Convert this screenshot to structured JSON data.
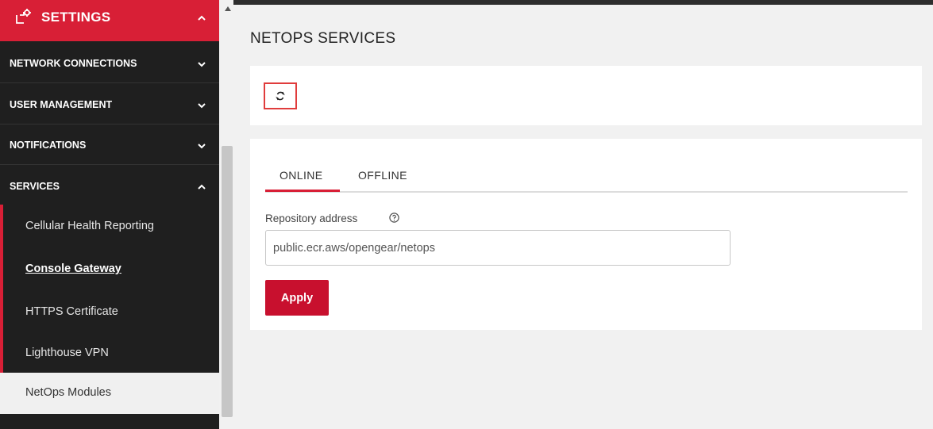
{
  "sidebar": {
    "header": {
      "title": "SETTINGS"
    },
    "items": [
      {
        "label": "NETWORK CONNECTIONS"
      },
      {
        "label": "USER MANAGEMENT"
      },
      {
        "label": "NOTIFICATIONS"
      },
      {
        "label": "SERVICES"
      }
    ],
    "services_items": [
      {
        "label": "Cellular Health Reporting"
      },
      {
        "label": "Console Gateway"
      },
      {
        "label": "HTTPS Certificate"
      },
      {
        "label": "Lighthouse VPN"
      },
      {
        "label": "NetOps Modules"
      }
    ],
    "active_item": "NetOps Modules"
  },
  "main": {
    "title": "NETOPS SERVICES",
    "tabs": [
      {
        "label": "ONLINE",
        "active": true
      },
      {
        "label": "OFFLINE",
        "active": false
      }
    ],
    "repository": {
      "label": "Repository address",
      "value": "public.ecr.aws/opengear/netops"
    },
    "apply_label": "Apply"
  },
  "colors": {
    "accent": "#d81f36",
    "sidebar_bg": "#1f1f1f",
    "page_bg": "#f1f1f1"
  },
  "icons": [
    "settings-icon",
    "chevron-up-icon",
    "chevron-down-icon",
    "refresh-icon",
    "help-icon",
    "scroll-up-arrow-icon"
  ]
}
